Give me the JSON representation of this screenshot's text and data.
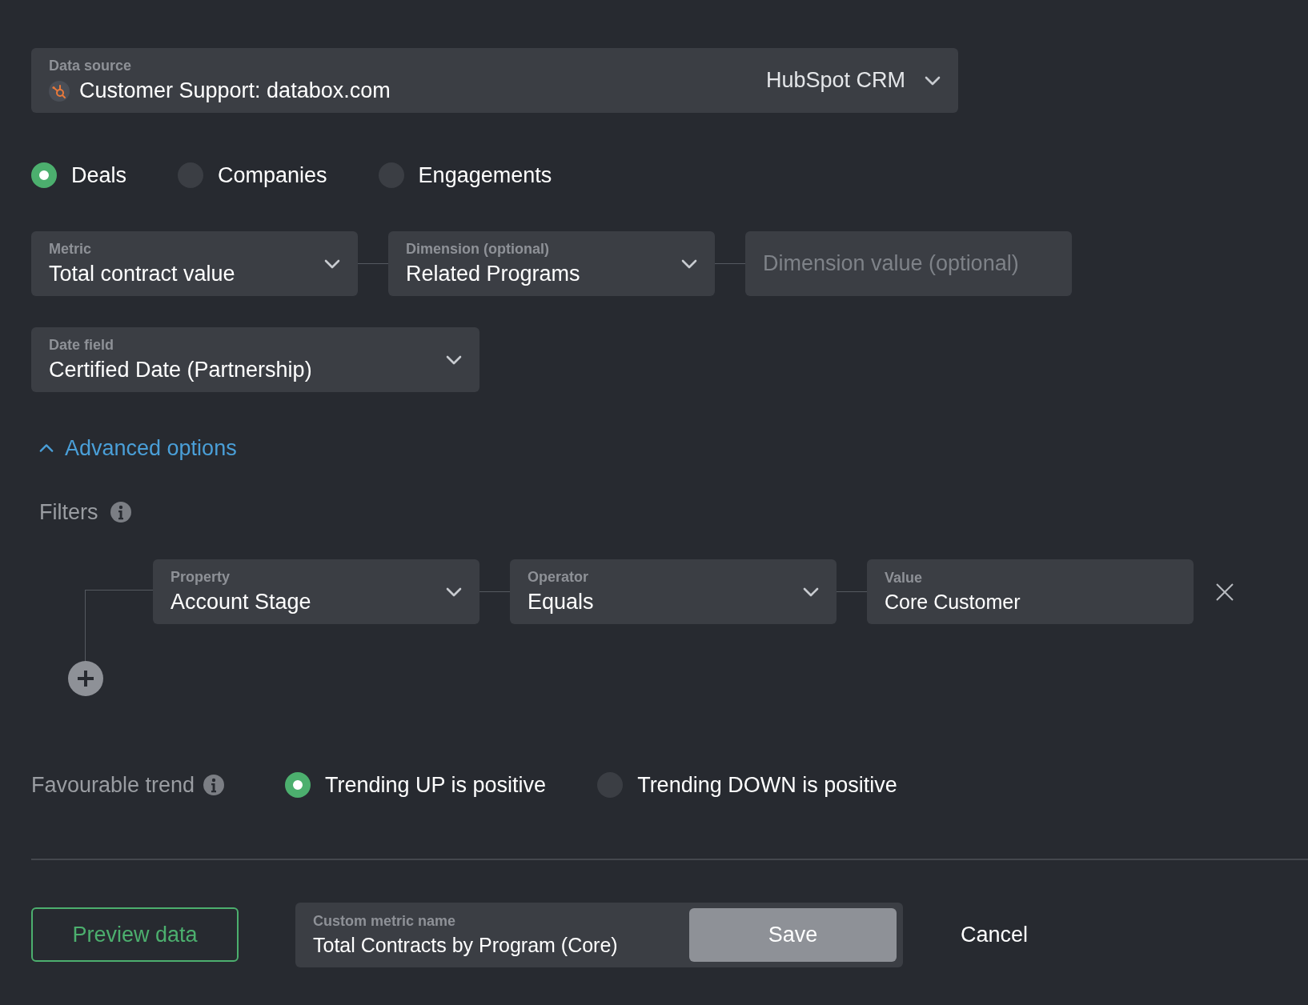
{
  "data_source": {
    "label": "Data source",
    "value": "Customer Support: databox.com",
    "provider": "HubSpot CRM"
  },
  "object_types": [
    {
      "label": "Deals",
      "selected": true
    },
    {
      "label": "Companies",
      "selected": false
    },
    {
      "label": "Engagements",
      "selected": false
    }
  ],
  "fields": [
    {
      "kind": "select",
      "label": "Metric",
      "value": "Total contract value"
    },
    {
      "kind": "select",
      "label": "Dimension (optional)",
      "value": "Related Programs"
    },
    {
      "kind": "input",
      "placeholder": "Dimension value (optional)"
    }
  ],
  "date_field": {
    "label": "Date field",
    "value": "Certified Date (Partnership)"
  },
  "advanced_options": {
    "label": "Advanced options",
    "expanded": true
  },
  "filters": {
    "title": "Filters",
    "rows": [
      {
        "fields": [
          {
            "kind": "select",
            "label": "Property",
            "value": "Account Stage"
          },
          {
            "kind": "select",
            "label": "Operator",
            "value": "Equals"
          },
          {
            "kind": "input",
            "label": "Value",
            "value": "Core Customer"
          }
        ]
      }
    ]
  },
  "trend": {
    "label": "Favourable trend",
    "options": [
      {
        "label": "Trending UP is positive",
        "selected": true
      },
      {
        "label": "Trending DOWN is positive",
        "selected": false
      }
    ]
  },
  "footer": {
    "preview_button": "Preview data",
    "name_field": {
      "label": "Custom metric name",
      "value": "Total Contracts by Program (Core)"
    },
    "save_button": "Save",
    "cancel_button": "Cancel"
  }
}
